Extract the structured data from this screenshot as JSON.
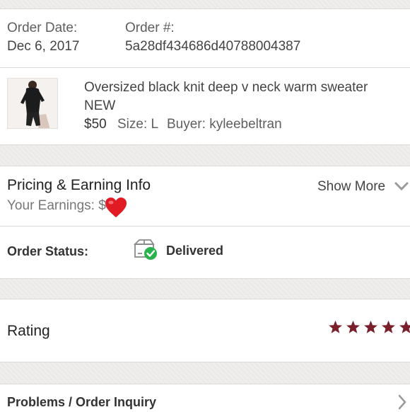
{
  "order": {
    "date_label": "Order Date:",
    "date_value": "Dec 6, 2017",
    "number_label": "Order #:",
    "number_value": "5a28df434686d40788004387"
  },
  "item": {
    "title_line1": "Oversized black knit deep v neck warm sweater",
    "title_line2": "NEW",
    "price": "$50",
    "size": "Size: L",
    "buyer": "Buyer: kyleebeltran"
  },
  "pricing": {
    "title": "Pricing & Earning Info",
    "earnings_label": "Your Earnings: $",
    "earnings_icon": "heart-emoji",
    "show_more": "Show More",
    "show_more_icon": "chevron-down-icon"
  },
  "status": {
    "label": "Order Status:",
    "value": "Delivered",
    "icon": "delivered-box-icon",
    "icon_check_color": "#2ab24d"
  },
  "rating": {
    "label": "Rating",
    "stars": 5,
    "max": 5,
    "star_color": "#7a1f2c"
  },
  "problems": {
    "label": "Problems / Order Inquiry",
    "icon": "chevron-right-icon"
  }
}
